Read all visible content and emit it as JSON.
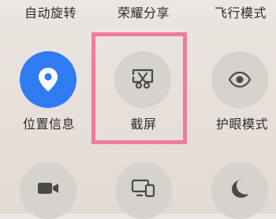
{
  "accent_color": "#2f7cf2",
  "highlight_color": "#f07aa0",
  "top_row": [
    {
      "label": "自动旋转"
    },
    {
      "label": "荣耀分享"
    },
    {
      "label": "飞行模式"
    }
  ],
  "middle_row": [
    {
      "label": "位置信息",
      "icon": "location-pin-icon",
      "state": "on"
    },
    {
      "label": "截屏",
      "icon": "screenshot-scissors-icon",
      "state": "off"
    },
    {
      "label": "护眼模式",
      "icon": "eye-icon",
      "state": "off"
    }
  ],
  "bottom_row": [
    {
      "icon": "video-camera-icon",
      "state": "off"
    },
    {
      "icon": "multi-screen-icon",
      "state": "off"
    },
    {
      "icon": "moon-icon",
      "state": "off"
    }
  ]
}
